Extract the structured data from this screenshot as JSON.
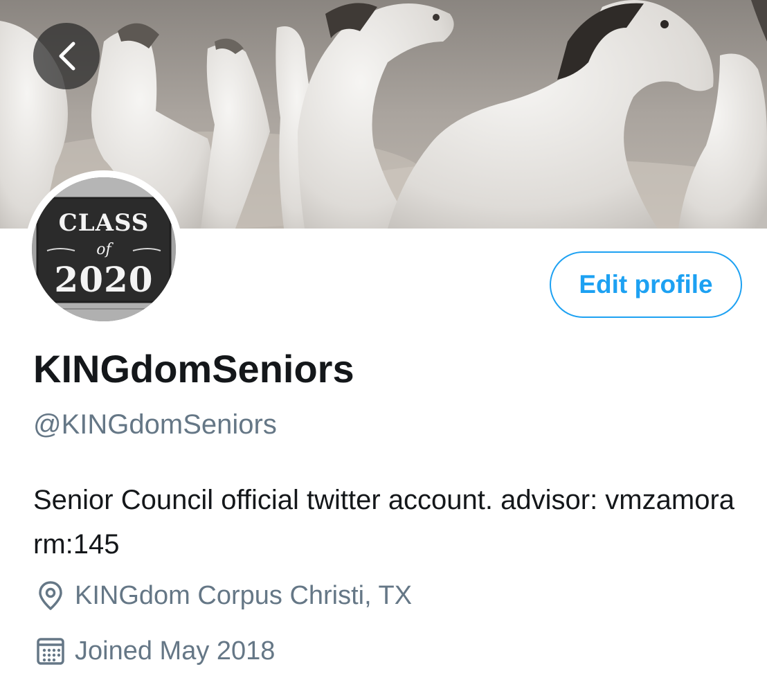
{
  "header": {
    "back_icon": "chevron-left-icon",
    "banner_description": "banner-photo"
  },
  "avatar": {
    "line1": "CLASS",
    "line2": "of",
    "line3": "2020"
  },
  "actions": {
    "edit_profile_label": "Edit profile"
  },
  "profile": {
    "display_name": "KINGdomSeniors",
    "handle": "@KINGdomSeniors",
    "bio": "Senior Council official twitter account. advisor: vmzamora rm:145",
    "location": "KINGdom Corpus Christi, TX",
    "location_icon": "map-pin-icon",
    "joined": "Joined May 2018",
    "joined_icon": "calendar-icon"
  },
  "colors": {
    "accent": "#1da1f2",
    "secondary_text": "#657786",
    "primary_text": "#14171a"
  }
}
